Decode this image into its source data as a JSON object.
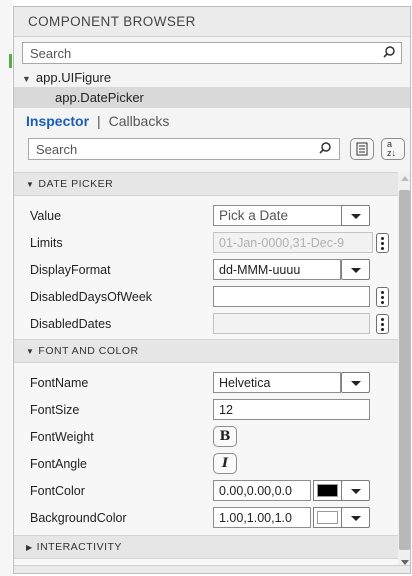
{
  "component_browser": {
    "title": "COMPONENT BROWSER",
    "search_placeholder": "Search",
    "tree": {
      "root": "app.UIFigure",
      "selected_child": "app.DatePicker"
    }
  },
  "inspector": {
    "tabs": [
      "Inspector",
      "Callbacks"
    ],
    "active_tab": "Inspector",
    "search_placeholder": "Search",
    "sort_icon_text": "a z",
    "sections": {
      "date_picker": {
        "title": "DATE PICKER",
        "value_label": "Value",
        "value": "Pick a Date",
        "limits_label": "Limits",
        "limits": "01-Jan-0000,31-Dec-9",
        "display_format_label": "DisplayFormat",
        "display_format": "dd-MMM-uuuu",
        "disabled_days_label": "DisabledDaysOfWeek",
        "disabled_days": "",
        "disabled_dates_label": "DisabledDates",
        "disabled_dates": ""
      },
      "font_and_color": {
        "title": "FONT AND COLOR",
        "font_name_label": "FontName",
        "font_name": "Helvetica",
        "font_size_label": "FontSize",
        "font_size": "12",
        "font_weight_label": "FontWeight",
        "font_weight_glyph": "B",
        "font_angle_label": "FontAngle",
        "font_angle_glyph": "I",
        "font_color_label": "FontColor",
        "font_color": "0.00,0.00,0.0",
        "font_color_swatch": "#000000",
        "background_color_label": "BackgroundColor",
        "background_color": "1.00,1.00,1.0",
        "background_color_swatch": "#ffffff"
      },
      "interactivity": {
        "title": "INTERACTIVITY"
      }
    }
  },
  "colors": {
    "accent": "#1a5db8",
    "selected_row": "#d9d9d9",
    "section_header": "#e6e6e6"
  },
  "icons": [
    "search-icon",
    "list-view-icon",
    "sort-alpha-icon",
    "expand-triangle-icon",
    "collapse-triangle-icon",
    "more-options-icon",
    "dropdown-arrow-icon"
  ]
}
